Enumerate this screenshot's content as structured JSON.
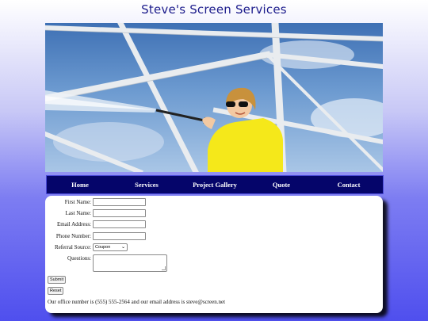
{
  "site": {
    "title": "Steve's Screen Services"
  },
  "hero": {
    "alt": "person pressure washing a pool screen enclosure"
  },
  "nav": {
    "items": [
      "Home",
      "Services",
      "Project Gallery",
      "Quote",
      "Contact"
    ]
  },
  "form": {
    "first_name_label": "First Name:",
    "last_name_label": "Last Name:",
    "email_label": "Email Address:",
    "phone_label": "Phone Number:",
    "referral_label": "Referral Source:",
    "referral_value": "Coupon",
    "questions_label": "Questions:",
    "submit_label": "Submit",
    "reset_label": "Reset"
  },
  "footer": {
    "contact_note": "Our office number is (555) 555-2564 and our email address is steve@screen.net"
  },
  "colors": {
    "nav_bg": "#05056a",
    "title": "#1c1c8c",
    "page_gradient_bottom": "#4f4fee"
  }
}
